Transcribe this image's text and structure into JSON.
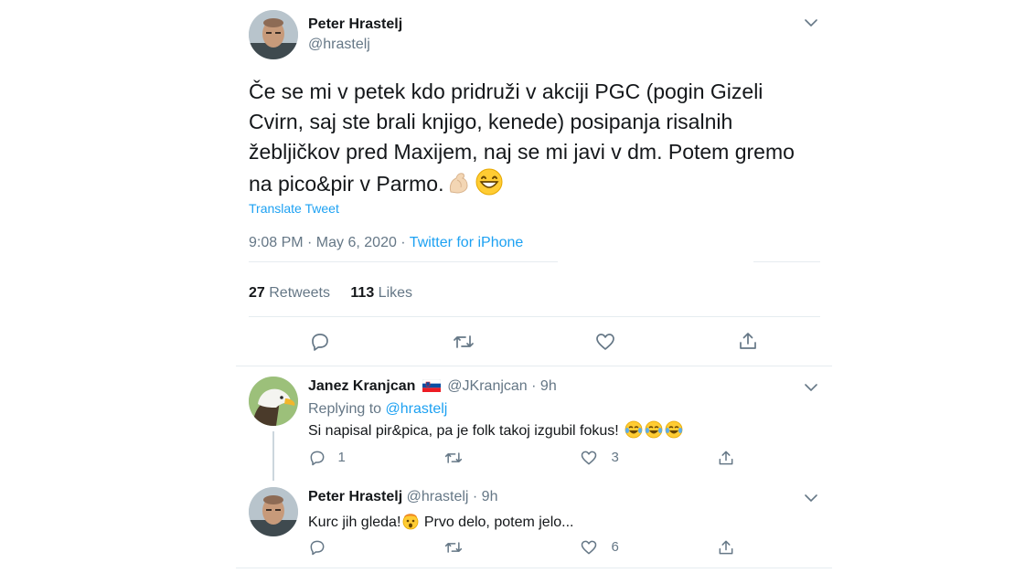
{
  "main_tweet": {
    "author_name": "Peter Hrastelj",
    "author_handle": "@hrastelj",
    "text": "Če se mi v petek kdo pridruži v akciji PGC (pogin Gizeli Cvirn, saj ste brali knjigo, kenede) posipanja risalnih žebljičkov pred Maxijem, naj se mi javi v dm. Potem gremo na pico&pir v Parmo.",
    "text_lines": [
      "Če se mi v petek kdo pridruži v akciji PGC (pogin Gizeli",
      "Cvirn, saj ste brali knjigo, kenede) posipanja risalnih",
      "žebljičkov pred Maxijem, naj se mi javi v dm. Potem gremo",
      "na pico&pir v Parmo."
    ],
    "translate_label": "Translate Tweet",
    "timestamp": "9:08 PM · May 6, 2020 · ",
    "source": "Twitter for iPhone",
    "retweets_count": "27",
    "retweets_label": "Retweets",
    "likes_count": "113",
    "likes_label": "Likes"
  },
  "replies": [
    {
      "author_name": "Janez Kranjcan",
      "flag_icon": "slovenia-flag-icon",
      "author_handle": "@JKranjcan",
      "time": "· 9h",
      "replying_label": "Replying to ",
      "replying_handle": "@hrastelj",
      "text": "Si napisal pir&pica, pa je folk takoj izgubil fokus!",
      "reply_count": "1",
      "retweet_count": "",
      "like_count": "3"
    },
    {
      "author_name": "Peter Hrastelj",
      "author_handle": "@hrastelj",
      "time": "· 9h",
      "text_before": "Kurc jih gleda!",
      "text_after": " Prvo delo, potem jelo...",
      "reply_count": "",
      "retweet_count": "",
      "like_count": "6"
    }
  ],
  "colors": {
    "accent": "#1da1f2",
    "text": "#14171a",
    "muted": "#657786",
    "divider": "#e6ecf0"
  }
}
